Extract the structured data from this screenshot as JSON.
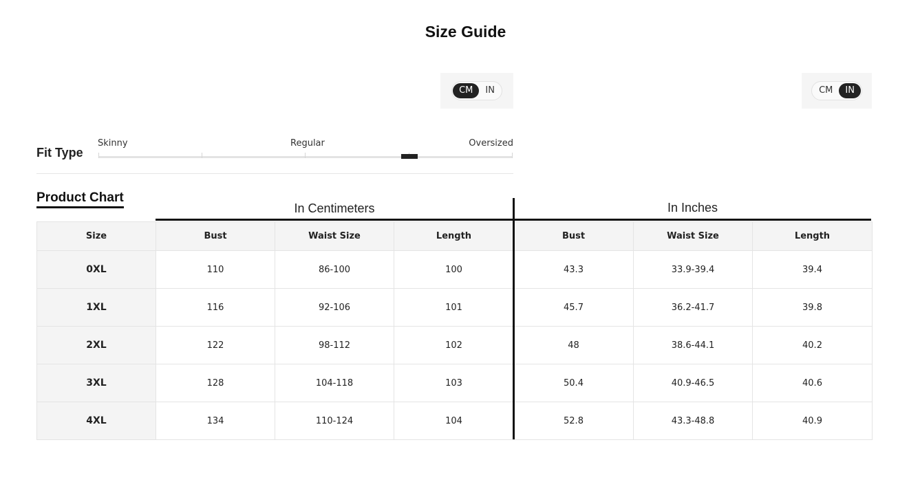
{
  "page_title": "Size Guide",
  "unit_toggles": {
    "left": {
      "options": [
        "CM",
        "IN"
      ],
      "selected": "CM"
    },
    "right": {
      "options": [
        "CM",
        "IN"
      ],
      "selected": "IN"
    }
  },
  "fit_type": {
    "label": "Fit Type",
    "scale_labels": [
      "Skinny",
      "Regular",
      "Oversized"
    ],
    "level": 0.75
  },
  "product_chart": {
    "title": "Product Chart",
    "group_cm": "In Centimeters",
    "group_in": "In Inches",
    "columns": [
      "Size",
      "Bust",
      "Waist Size",
      "Length",
      "Bust",
      "Waist Size",
      "Length"
    ],
    "rows": [
      [
        "0XL",
        "110",
        "86-100",
        "100",
        "43.3",
        "33.9-39.4",
        "39.4"
      ],
      [
        "1XL",
        "116",
        "92-106",
        "101",
        "45.7",
        "36.2-41.7",
        "39.8"
      ],
      [
        "2XL",
        "122",
        "98-112",
        "102",
        "48",
        "38.6-44.1",
        "40.2"
      ],
      [
        "3XL",
        "128",
        "104-118",
        "103",
        "50.4",
        "40.9-46.5",
        "40.6"
      ],
      [
        "4XL",
        "134",
        "110-124",
        "104",
        "52.8",
        "43.3-48.8",
        "40.9"
      ]
    ]
  }
}
